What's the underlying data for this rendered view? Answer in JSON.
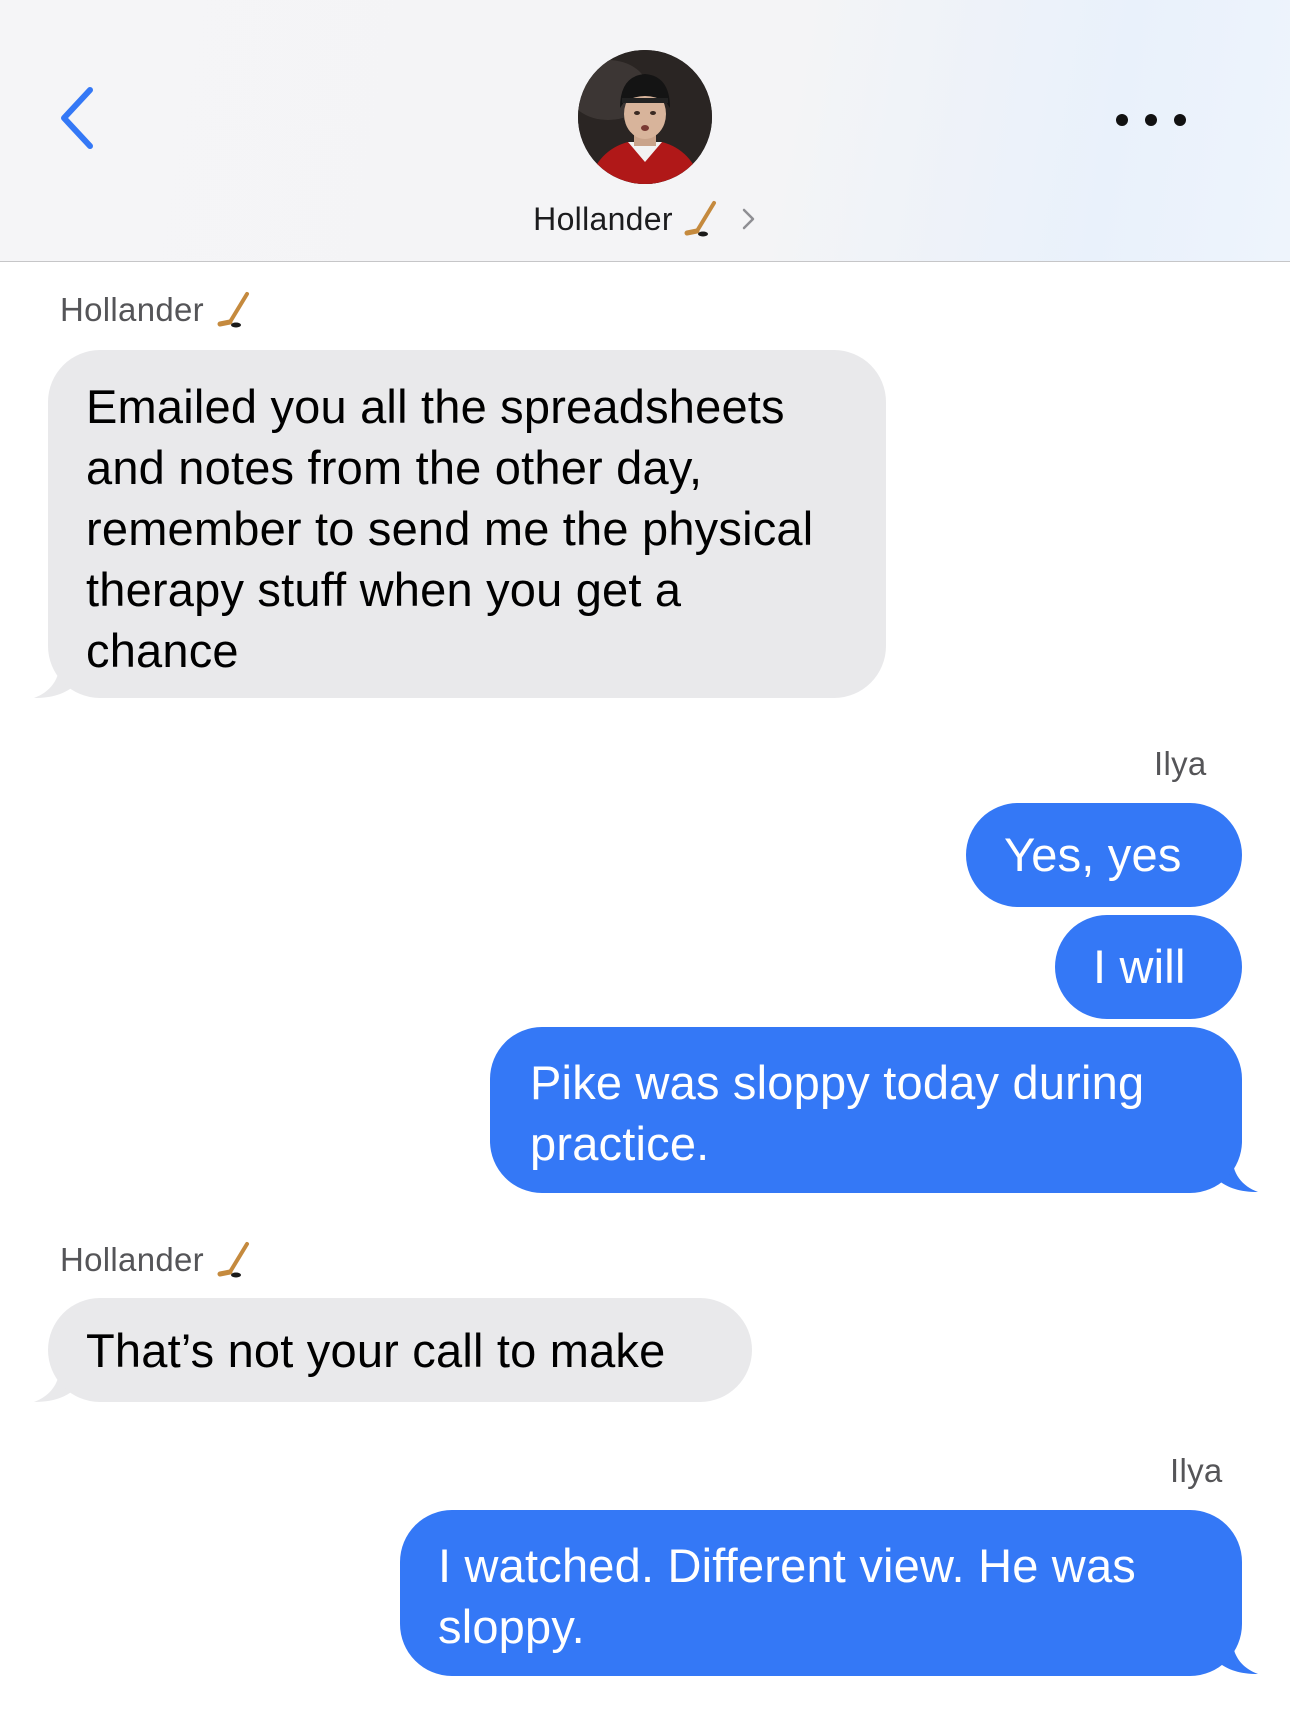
{
  "header": {
    "contact_name": "Hollander",
    "avatar_icon": "hockey-player-photo",
    "back_icon": "chevron-left-icon",
    "more_icon": "ellipsis-icon",
    "accent_color": "#3478f6"
  },
  "messages": [
    {
      "sender": "Hollander",
      "direction": "incoming",
      "text": "Emailed you all the spreadsheets and notes from the other day, remember to send me the physical therapy stuff when you get a chance"
    },
    {
      "sender": "Ilya",
      "direction": "outgoing",
      "text": "Yes, yes"
    },
    {
      "direction": "outgoing",
      "text": "I will"
    },
    {
      "direction": "outgoing",
      "text": "Pike was sloppy today during practice."
    },
    {
      "sender": "Hollander",
      "direction": "incoming",
      "text": "That’s not your call to make"
    },
    {
      "sender": "Ilya",
      "direction": "outgoing",
      "text": "I watched. Different view. He was sloppy."
    }
  ],
  "colors": {
    "incoming_bubble": "#e9e9eb",
    "outgoing_bubble": "#3478f6"
  }
}
